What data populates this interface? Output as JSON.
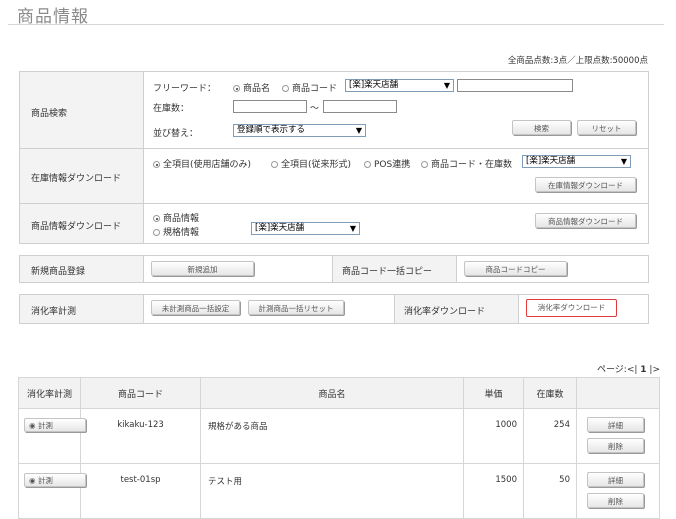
{
  "page": {
    "title": "商品情報",
    "count_text": "全商品点数:3点／上限点数:50000点"
  },
  "search": {
    "label": "商品検索",
    "freeword_label": "フリーワード：",
    "opt_name": "商品名",
    "opt_code": "商品コード",
    "shop_select": "[楽]楽天店舗",
    "stock_label": "在庫数：",
    "tilde": "〜",
    "sort_label": "並び替え：",
    "sort_select": "登録順で表示する",
    "search_btn": "検索",
    "reset_btn": "リセット"
  },
  "stock_dl": {
    "label": "在庫情報ダウンロード",
    "opt_all": "全項目(使用店舗のみ)",
    "opt_old": "全項目(従来形式)",
    "opt_pos": "POS連携",
    "opt_code_stock": "商品コード・在庫数",
    "shop_select": "[楽]楽天店舗",
    "btn": "在庫情報ダウンロード"
  },
  "product_dl": {
    "label": "商品情報ダウンロード",
    "opt_product": "商品情報",
    "opt_spec": "規格情報",
    "shop_select": "[楽]楽天店舗",
    "btn": "商品情報ダウンロード"
  },
  "register": {
    "label": "新規商品登録",
    "btn": "新規追加",
    "copy_label": "商品コード一括コピー",
    "copy_btn": "商品コードコピー"
  },
  "digest": {
    "label": "消化率計測",
    "btn_set": "未計測商品一括設定",
    "btn_reset": "計測商品一括リセット",
    "dl_label": "消化率ダウンロード",
    "dl_btn": "消化率ダウンロード"
  },
  "pager": {
    "text": "ページ:<|",
    "current": "1",
    "end": "|>"
  },
  "table": {
    "headers": [
      "消化率計測",
      "商品コード",
      "商品名",
      "単価",
      "在庫数",
      ""
    ],
    "rows": [
      {
        "measure": "計測",
        "code": "kikaku-123",
        "name": "規格がある商品",
        "price": "1000",
        "stock": "254",
        "detail": "詳細",
        "delete": "削除"
      },
      {
        "measure": "計測",
        "code": "test-01sp",
        "name": "テスト用",
        "price": "1500",
        "stock": "50",
        "detail": "詳細",
        "delete": "削除"
      }
    ]
  }
}
